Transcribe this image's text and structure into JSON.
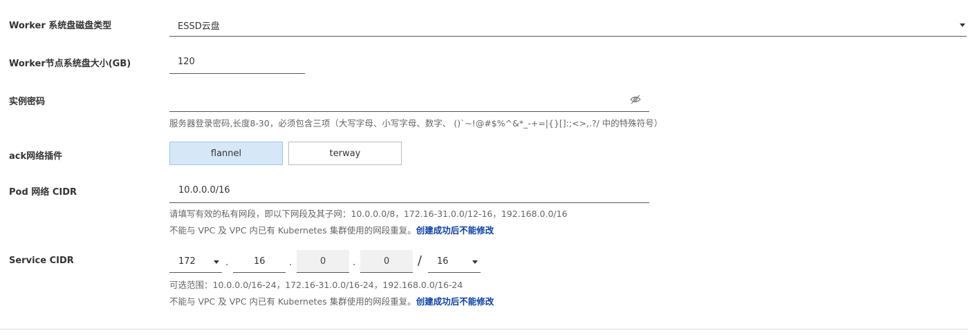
{
  "disk_type": {
    "label": "Worker 系统盘磁盘类型",
    "value": "ESSD云盘"
  },
  "disk_size": {
    "label": "Worker节点系统盘大小(GB)",
    "value": "120"
  },
  "password": {
    "label": "实例密码",
    "value": "",
    "help": "服务器登录密码,长度8-30，必须包含三项（大写字母、小写字母、数字、 ()`~!@#$%^&*_-+=|{}[]:;<>,.?/ 中的特殊符号）"
  },
  "network_plugin": {
    "label": "ack网络插件",
    "options": [
      "flannel",
      "terway"
    ],
    "selected": "flannel"
  },
  "pod_cidr": {
    "label": "Pod 网络 CIDR",
    "value": "10.0.0.0/16",
    "help1": "请填写有效的私有网段，即以下网段及其子网：10.0.0.0/8，172.16-31.0.0/12-16，192.168.0.0/16",
    "help2": "不能与 VPC 及 VPC 内已有 Kubernetes 集群使用的网段重复。",
    "help2_strong": "创建成功后不能修改"
  },
  "service_cidr": {
    "label": "Service CIDR",
    "octet1": "172",
    "octet2": "16",
    "octet3": "0",
    "octet4": "0",
    "slash": "/",
    "mask": "16",
    "dot": ".",
    "help1": "可选范围：10.0.0.0/16-24，172.16-31.0.0/16-24，192.168.0.0/16-24",
    "help2": "不能与 VPC 及 VPC 内已有 Kubernetes 集群使用的网段重复。",
    "help2_strong": "创建成功后不能修改"
  },
  "colors": {
    "accent": "#0a3fa6",
    "selected_bg": "#d6e8f8",
    "selected_border": "#9cc4e8"
  }
}
